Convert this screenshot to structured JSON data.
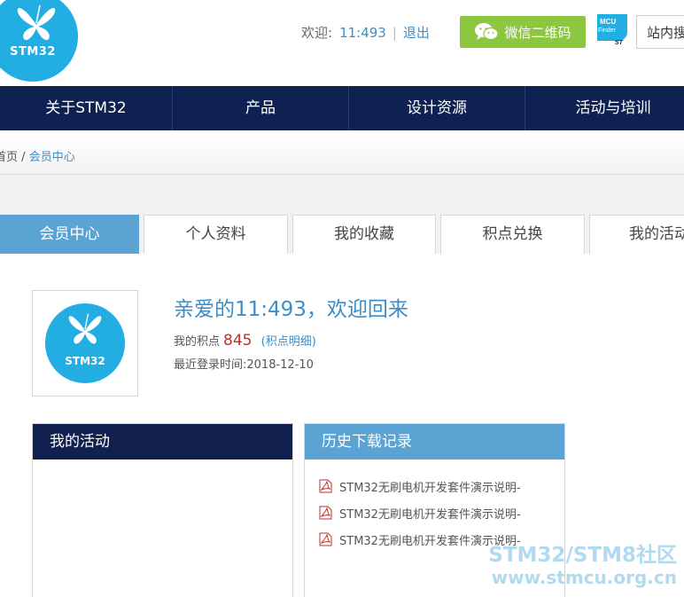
{
  "header": {
    "logo_text": "STM32",
    "welcome_label": "欢迎:",
    "username": "11:493",
    "logout": "退出",
    "wechat_button": "微信二维码",
    "mcu_finder_line1": "MCU",
    "mcu_finder_line2": "Finder",
    "search_placeholder": "站内搜"
  },
  "nav": {
    "items": [
      {
        "label": "关于STM32"
      },
      {
        "label": "产品"
      },
      {
        "label": "设计资源"
      },
      {
        "label": "活动与培训"
      }
    ]
  },
  "breadcrumb": {
    "home": "首页",
    "separator": "/",
    "current": "会员中心"
  },
  "tabs": [
    {
      "label": "会员中心",
      "active": true
    },
    {
      "label": "个人资料",
      "active": false
    },
    {
      "label": "我的收藏",
      "active": false
    },
    {
      "label": "积点兑换",
      "active": false
    },
    {
      "label": "我的活动",
      "active": false
    }
  ],
  "profile": {
    "avatar_text": "STM32",
    "greeting": "亲爱的11:493，欢迎回来",
    "points_label": "我的积点",
    "points_value": "845",
    "points_detail_link": "积点明细",
    "last_login_label": "最近登录时间:",
    "last_login_value": "2018-12-10"
  },
  "panels": {
    "activity_title": "我的活动",
    "history_title": "历史下载记录",
    "downloads": [
      {
        "name": "STM32无刷电机开发套件演示说明-"
      },
      {
        "name": "STM32无刷电机开发套件演示说明-"
      },
      {
        "name": "STM32无刷电机开发套件演示说明-"
      }
    ]
  },
  "watermark": {
    "line1": "STM32/STM8社区",
    "line2": "www.stmcu.org.cn"
  },
  "colors": {
    "brand_blue": "#23aee3",
    "nav_navy": "#0f2150",
    "tab_active": "#5aa3d3",
    "wechat_green": "#8dc63f",
    "link_blue": "#3a8fc9",
    "points_red": "#c0302a"
  }
}
